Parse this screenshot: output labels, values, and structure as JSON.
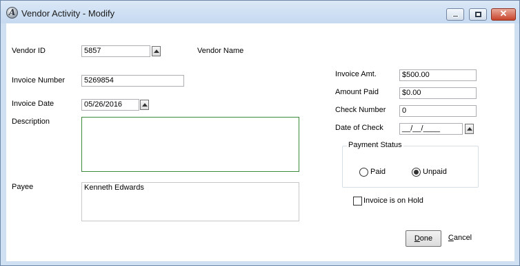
{
  "window": {
    "title": "Vendor Activity - Modify"
  },
  "form": {
    "vendor_id": {
      "label": "Vendor ID",
      "value": "5857"
    },
    "vendor_name": {
      "label": "Vendor Name",
      "value": ""
    },
    "invoice_number": {
      "label": "Invoice Number",
      "value": "5269854"
    },
    "invoice_date": {
      "label": "Invoice Date",
      "value": "05/26/2016"
    },
    "description": {
      "label": "Description",
      "value": ""
    },
    "payee": {
      "label": "Payee",
      "value": "Kenneth Edwards"
    },
    "invoice_amt": {
      "label": "Invoice Amt.",
      "value": "$500.00"
    },
    "amount_paid": {
      "label": "Amount Paid",
      "value": "$0.00"
    },
    "check_number": {
      "label": "Check Number",
      "value": "0"
    },
    "date_of_check": {
      "label": "Date of Check",
      "value": "__/__/____"
    },
    "payment_status": {
      "title": "Payment Status",
      "options": [
        {
          "label": "Paid",
          "selected": false
        },
        {
          "label": "Unpaid",
          "selected": true
        }
      ]
    },
    "on_hold": {
      "label": "Invoice is on Hold",
      "checked": false
    }
  },
  "buttons": {
    "done_first": "D",
    "done_rest": "one",
    "cancel_first": "C",
    "cancel_rest": "ancel"
  },
  "colors": {
    "description_border": "#3a8a3a",
    "title_bar": "#c5d9f0",
    "close_button": "#c7432a"
  }
}
